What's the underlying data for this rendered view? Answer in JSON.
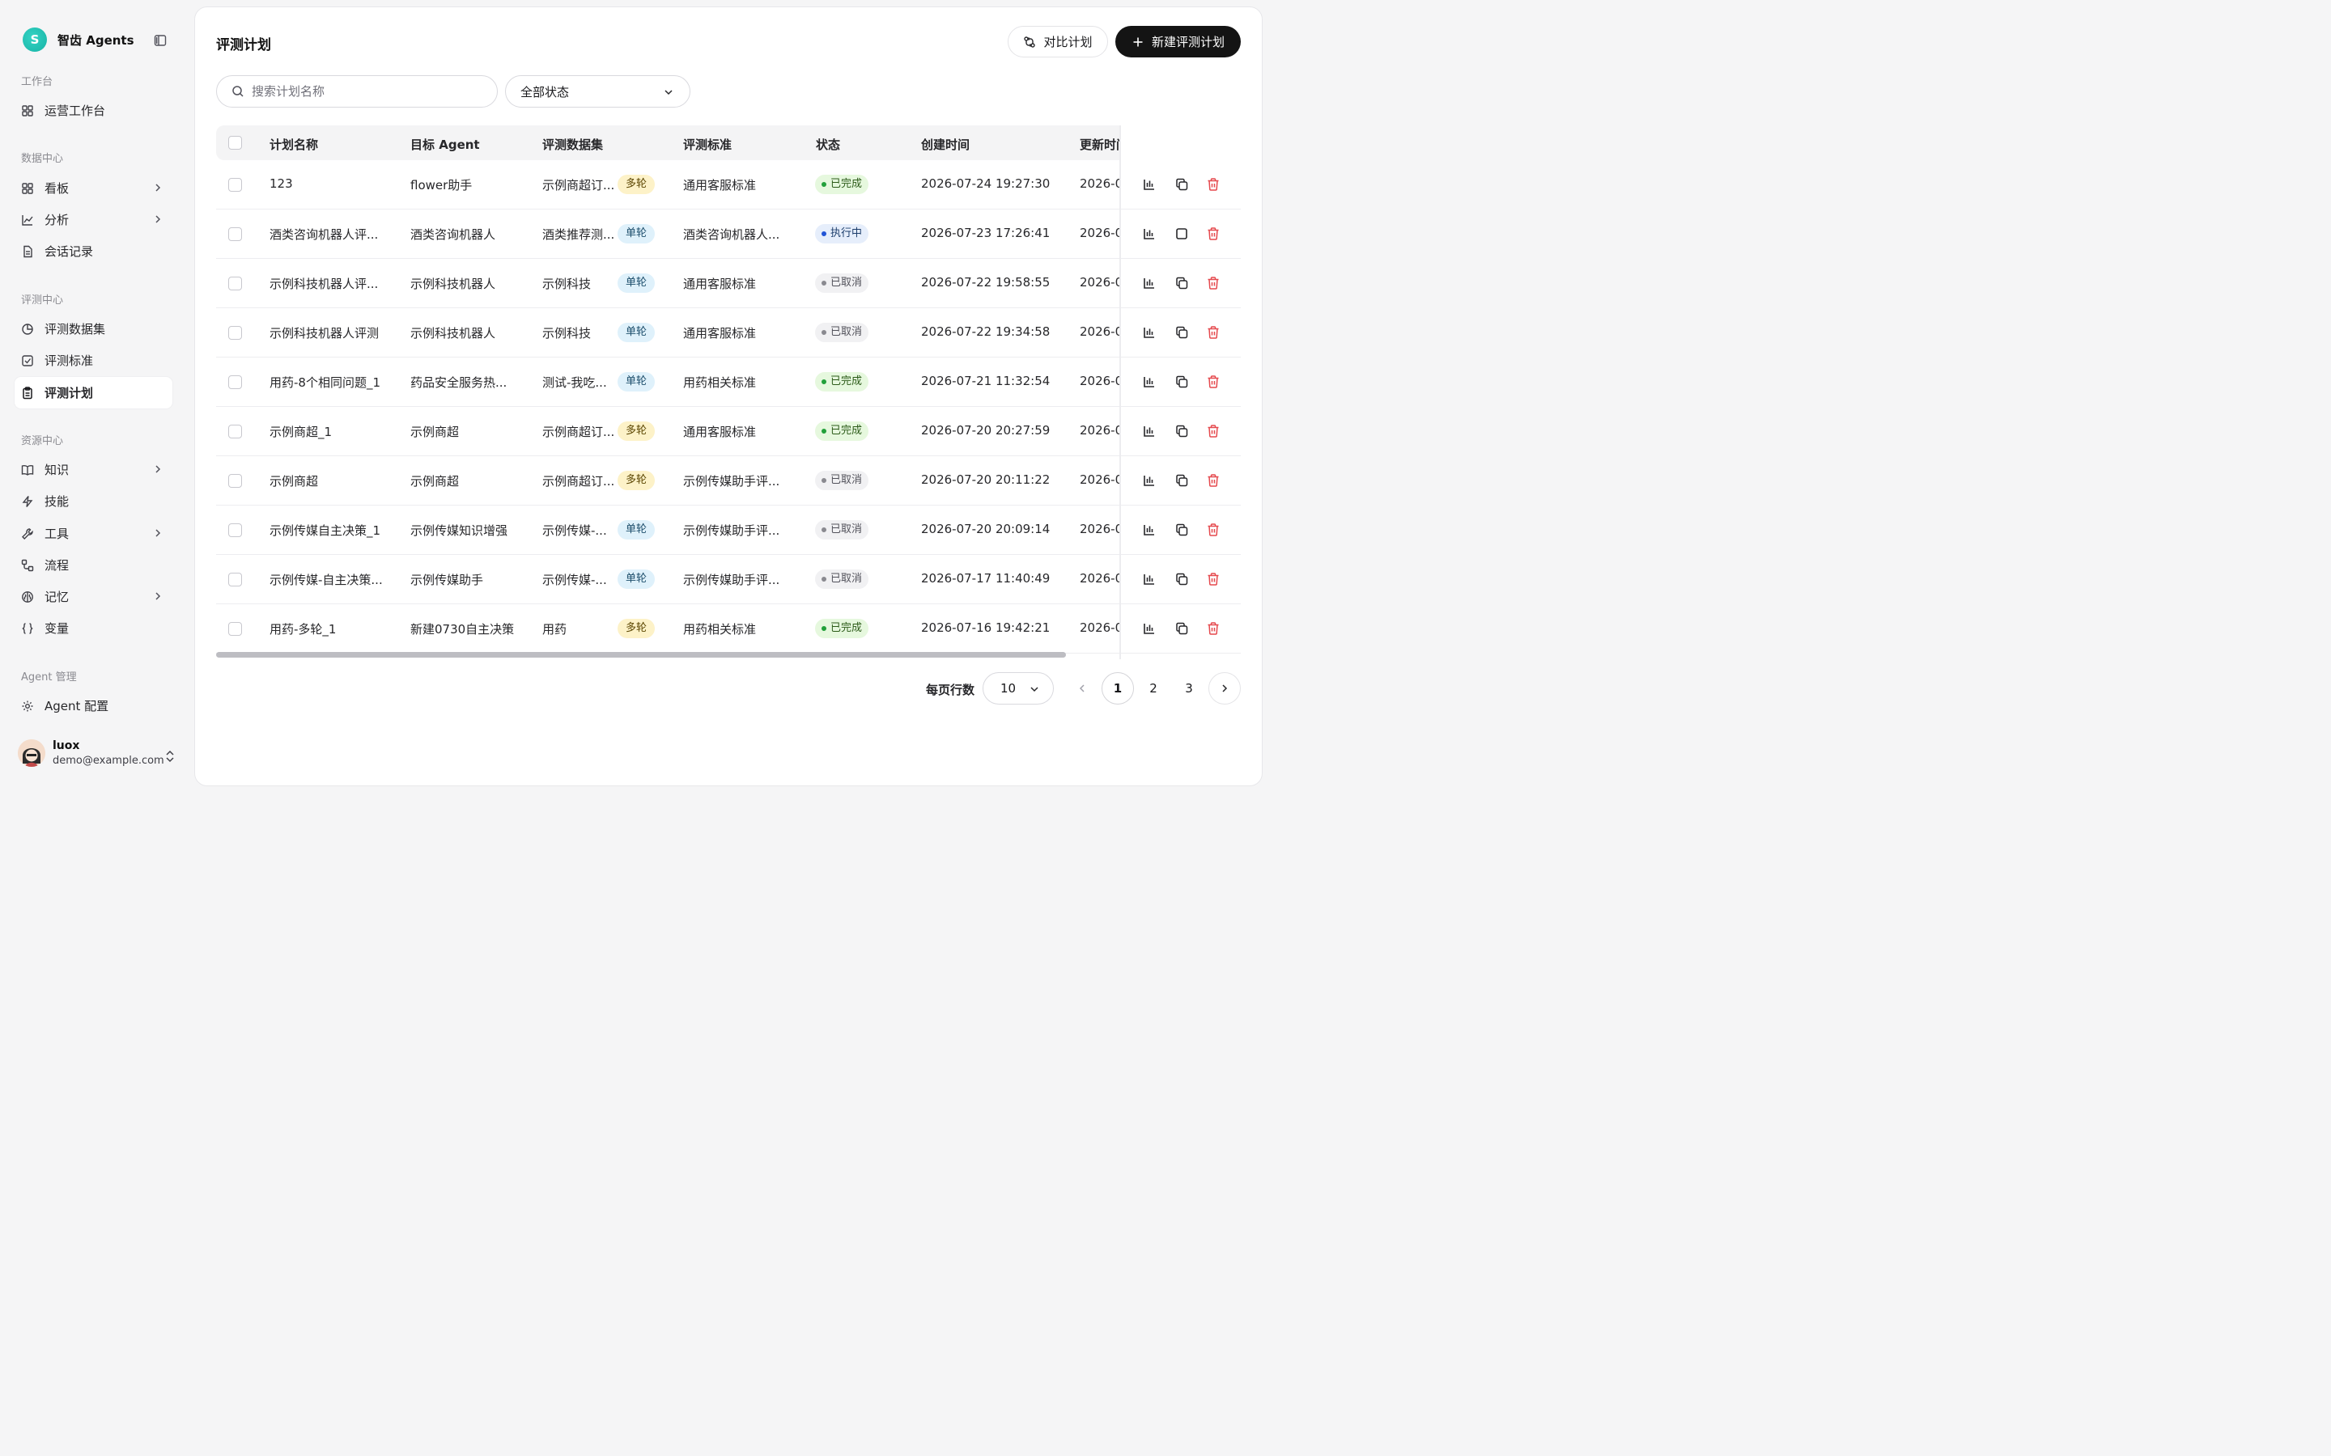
{
  "brand": {
    "logo_letter": "S",
    "name": "智齿 Agents"
  },
  "sidebar": {
    "sections": [
      {
        "label": "工作台"
      },
      {
        "label": "数据中心"
      },
      {
        "label": "评测中心"
      },
      {
        "label": "资源中心"
      },
      {
        "label": "Agent 管理"
      }
    ],
    "items": [
      {
        "label": "运营工作台",
        "icon": "grid-icon"
      },
      {
        "label": "看板",
        "icon": "dashboard-icon",
        "has_children": true
      },
      {
        "label": "分析",
        "icon": "chart-line-icon",
        "has_children": true
      },
      {
        "label": "会话记录",
        "icon": "file-icon"
      },
      {
        "label": "评测数据集",
        "icon": "pie-icon"
      },
      {
        "label": "评测标准",
        "icon": "check-square-icon"
      },
      {
        "label": "评测计划",
        "icon": "clipboard-icon",
        "active": true
      },
      {
        "label": "知识",
        "icon": "book-icon",
        "has_children": true
      },
      {
        "label": "技能",
        "icon": "bolt-icon"
      },
      {
        "label": "工具",
        "icon": "wrench-icon",
        "has_children": true
      },
      {
        "label": "流程",
        "icon": "workflow-icon"
      },
      {
        "label": "记忆",
        "icon": "brain-icon",
        "has_children": true
      },
      {
        "label": "变量",
        "icon": "braces-icon"
      },
      {
        "label": "Agent 配置",
        "icon": "gear-icon"
      }
    ]
  },
  "user": {
    "name": "luox",
    "email": "demo@example.com"
  },
  "page": {
    "title": "评测计划",
    "compare_label": "对比计划",
    "new_label": "新建评测计划",
    "search_placeholder": "搜索计划名称",
    "status_filter": "全部状态"
  },
  "table": {
    "columns": [
      "计划名称",
      "目标 Agent",
      "评测数据集",
      "评测标准",
      "状态",
      "创建时间",
      "更新时间"
    ],
    "rows": [
      {
        "name": "123",
        "agent": "flower助手",
        "dataset": "示例商超订...",
        "mode": "多轮",
        "standard": "通用客服标准",
        "status": "已完成",
        "status_type": "done",
        "created": "2026-07-24 19:27:30",
        "updated": "2026-0"
      },
      {
        "name": "酒类咨询机器人评...",
        "agent": "酒类咨询机器人",
        "dataset": "酒类推荐测...",
        "mode": "单轮",
        "standard": "酒类咨询机器人...",
        "status": "执行中",
        "status_type": "running",
        "created": "2026-07-23 17:26:41",
        "updated": "2026-0"
      },
      {
        "name": "示例科技机器人评...",
        "agent": "示例科技机器人",
        "dataset": "示例科技",
        "mode": "单轮",
        "standard": "通用客服标准",
        "status": "已取消",
        "status_type": "cancelled",
        "created": "2026-07-22 19:58:55",
        "updated": "2026-0"
      },
      {
        "name": "示例科技机器人评测",
        "agent": "示例科技机器人",
        "dataset": "示例科技",
        "mode": "单轮",
        "standard": "通用客服标准",
        "status": "已取消",
        "status_type": "cancelled",
        "created": "2026-07-22 19:34:58",
        "updated": "2026-0"
      },
      {
        "name": "用药-8个相同问题_1",
        "agent": "药品安全服务热...",
        "dataset": "测试-我吃...",
        "mode": "单轮",
        "standard": "用药相关标准",
        "status": "已完成",
        "status_type": "done",
        "created": "2026-07-21 11:32:54",
        "updated": "2026-0"
      },
      {
        "name": "示例商超_1",
        "agent": "示例商超",
        "dataset": "示例商超订...",
        "mode": "多轮",
        "standard": "通用客服标准",
        "status": "已完成",
        "status_type": "done",
        "created": "2026-07-20 20:27:59",
        "updated": "2026-0"
      },
      {
        "name": "示例商超",
        "agent": "示例商超",
        "dataset": "示例商超订...",
        "mode": "多轮",
        "standard": "示例传媒助手评...",
        "status": "已取消",
        "status_type": "cancelled",
        "created": "2026-07-20 20:11:22",
        "updated": "2026-0"
      },
      {
        "name": "示例传媒自主决策_1",
        "agent": "示例传媒知识增强",
        "dataset": "示例传媒-...",
        "mode": "单轮",
        "standard": "示例传媒助手评...",
        "status": "已取消",
        "status_type": "cancelled",
        "created": "2026-07-20 20:09:14",
        "updated": "2026-0"
      },
      {
        "name": "示例传媒-自主决策...",
        "agent": "示例传媒助手",
        "dataset": "示例传媒-...",
        "mode": "单轮",
        "standard": "示例传媒助手评...",
        "status": "已取消",
        "status_type": "cancelled",
        "created": "2026-07-17 11:40:49",
        "updated": "2026-0"
      },
      {
        "name": "用药-多轮_1",
        "agent": "新建0730自主决策",
        "dataset": "用药",
        "mode": "多轮",
        "standard": "用药相关标准",
        "status": "已完成",
        "status_type": "done",
        "created": "2026-07-16 19:42:21",
        "updated": "2026-0"
      }
    ]
  },
  "pagination": {
    "per_page_label": "每页行数",
    "per_page": "10",
    "pages": [
      "1",
      "2",
      "3"
    ],
    "current": "1"
  },
  "colors": {
    "primary": "#141414",
    "brand": "#1fbfb0",
    "danger": "#e5484d"
  }
}
